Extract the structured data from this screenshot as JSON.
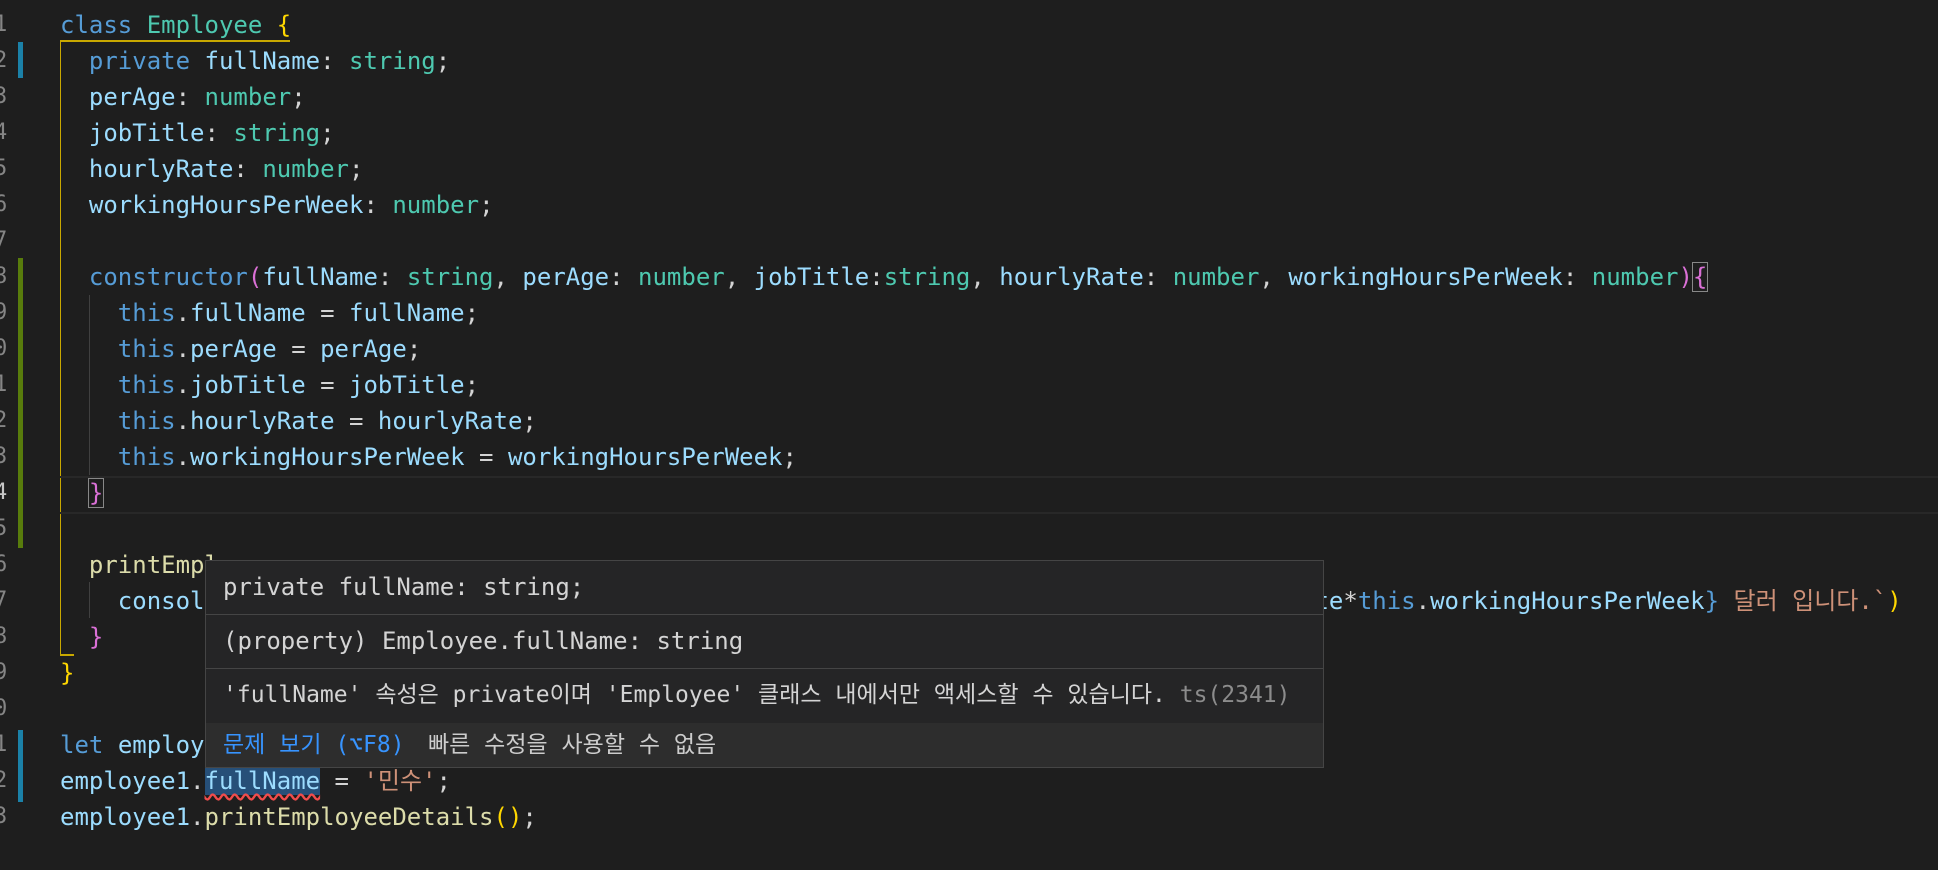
{
  "editor": {
    "line_numbers": [
      "1",
      "2",
      "3",
      "4",
      "5",
      "6",
      "7",
      "8",
      "9",
      "0",
      "1",
      "2",
      "3",
      "4",
      "5",
      "6",
      "7",
      "8",
      "9",
      "0",
      "1",
      "2",
      "3"
    ],
    "lines": {
      "l1": {
        "kw": "class",
        "name": "Employee",
        "brace": "{"
      },
      "l2": {
        "kw": "private",
        "prop": "fullName",
        "colon": ":",
        "type": "string",
        "semi": ";"
      },
      "l3": {
        "prop": "perAge",
        "colon": ":",
        "type": "number",
        "semi": ";"
      },
      "l4": {
        "prop": "jobTitle",
        "colon": ":",
        "type": "string",
        "semi": ";"
      },
      "l5": {
        "prop": "hourlyRate",
        "colon": ":",
        "type": "number",
        "semi": ";"
      },
      "l6": {
        "prop": "workingHoursPerWeek",
        "colon": ":",
        "type": "number",
        "semi": ";"
      },
      "l8": {
        "kw": "constructor",
        "open": "(",
        "p1": "fullName",
        "t1": "string",
        "p2": "perAge",
        "t2": "number",
        "p3": "jobTitle",
        "t3": "string",
        "p4": "hourlyRate",
        "t4": "number",
        "p5": "workingHoursPerWeek",
        "t5": "number",
        "close": ")",
        "brace": "{",
        "colon": ":",
        "comma": ",",
        "colon_nospace": ":"
      },
      "l9": {
        "this": "this",
        "prop": "fullName",
        "eq": " = ",
        "val": "fullName",
        "semi": ";"
      },
      "l10": {
        "this": "this",
        "prop": "perAge",
        "eq": " = ",
        "val": "perAge",
        "semi": ";"
      },
      "l11": {
        "this": "this",
        "prop": "jobTitle",
        "eq": " = ",
        "val": "jobTitle",
        "semi": ";"
      },
      "l12": {
        "this": "this",
        "prop": "hourlyRate",
        "eq": " = ",
        "val": "hourlyRate",
        "semi": ";"
      },
      "l13": {
        "this": "this",
        "prop": "workingHoursPerWeek",
        "eq": " = ",
        "val": "workingHoursPerWeek",
        "semi": ";"
      },
      "l14": {
        "brace": "}"
      },
      "l16": {
        "fn": "printEmpl"
      },
      "l17": {
        "prefix": "consol",
        "tail_prop": "ate",
        "star": "*",
        "this": "this",
        "dot": ".",
        "tail_prop2": "workingHoursPerWeek",
        "tpl_close": "}",
        "str": " 달러 입니다.`",
        "close": ")"
      },
      "l18": {
        "brace": "}"
      },
      "l19": {
        "brace": "}"
      },
      "l21": {
        "kw": "let",
        "name": "employ"
      },
      "l22": {
        "obj": "employee1",
        "dot": ".",
        "prop": "fullName",
        "eq": " = ",
        "str": "'민수'",
        "semi": ";"
      },
      "l23": {
        "obj": "employee1",
        "dot": ".",
        "fn": "printEmployeeDetails",
        "open": "(",
        "close": ")",
        "semi": ";"
      }
    }
  },
  "hover": {
    "signature": "private fullName: string;",
    "property_line": "(property) Employee.fullName: string",
    "error_message": "'fullName' 속성은 private이며 'Employee' 클래스 내에서만 액세스할 수 있습니다.",
    "error_code": "ts(2341)",
    "view_problem": "문제 보기 (⌥F8)",
    "no_quick_fix": "빠른 수정을 사용할 수 없음"
  },
  "colors": {
    "background": "#1e1e1e",
    "keyword": "#569cd6",
    "type": "#4ec9b0",
    "property": "#9cdcfe",
    "function": "#dcdcaa",
    "string": "#ce9178",
    "link": "#3794ff",
    "error": "#f14c4c"
  }
}
